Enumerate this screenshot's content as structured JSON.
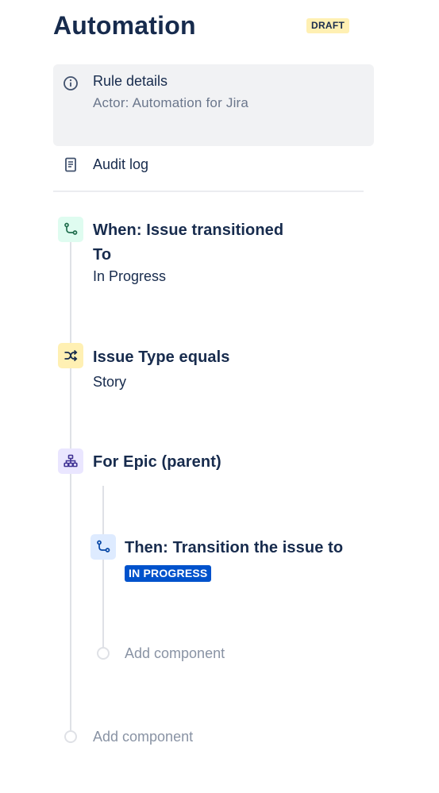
{
  "header": {
    "title": "Automation",
    "badge": "DRAFT"
  },
  "rule_details": {
    "title": "Rule details",
    "actor": "Actor: Automation for Jira",
    "icon": "info-icon"
  },
  "audit_log": {
    "label": "Audit log",
    "icon": "document-icon"
  },
  "components": {
    "trigger": {
      "title_line1": "When: Issue transitioned",
      "title_line2": "To",
      "subtitle": "In Progress",
      "icon": "transition-icon",
      "color": "#dffcf0"
    },
    "condition": {
      "title": "Issue Type equals",
      "subtitle": "Story",
      "icon": "shuffle-icon",
      "color": "#fff0b3"
    },
    "branch": {
      "title": "For Epic (parent)",
      "icon": "hierarchy-icon",
      "color": "#eae6ff"
    },
    "action": {
      "title": "Then: Transition the issue to",
      "status": "IN PROGRESS",
      "icon": "transition-icon",
      "color": "#deebff",
      "status_color": "#0052cc"
    }
  },
  "add_component": {
    "inner_label": "Add component",
    "outer_label": "Add component"
  }
}
